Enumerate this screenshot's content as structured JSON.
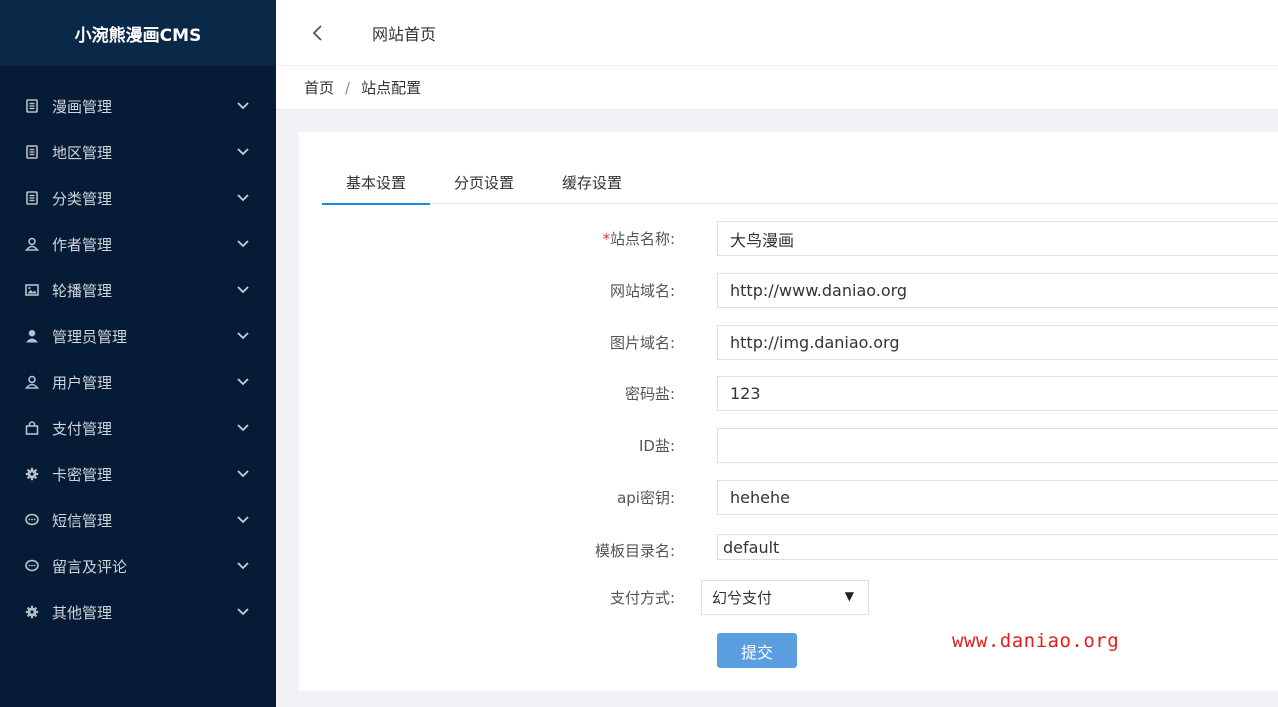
{
  "app": {
    "logo": "小涴熊漫画CMS"
  },
  "sidebar": {
    "items": [
      {
        "label": "漫画管理",
        "icon": "book-icon"
      },
      {
        "label": "地区管理",
        "icon": "book-icon"
      },
      {
        "label": "分类管理",
        "icon": "book-icon"
      },
      {
        "label": "作者管理",
        "icon": "user-outline-icon"
      },
      {
        "label": "轮播管理",
        "icon": "image-icon"
      },
      {
        "label": "管理员管理",
        "icon": "user-icon"
      },
      {
        "label": "用户管理",
        "icon": "user-outline-icon"
      },
      {
        "label": "支付管理",
        "icon": "bag-icon"
      },
      {
        "label": "卡密管理",
        "icon": "gear-icon"
      },
      {
        "label": "短信管理",
        "icon": "chat-icon"
      },
      {
        "label": "留言及评论",
        "icon": "chat-icon"
      },
      {
        "label": "其他管理",
        "icon": "gear-icon"
      }
    ]
  },
  "header": {
    "title": "网站首页"
  },
  "breadcrumb": {
    "home": "首页",
    "separator": "/",
    "current": "站点配置"
  },
  "tabs": [
    {
      "label": "基本设置",
      "active": true
    },
    {
      "label": "分页设置",
      "active": false
    },
    {
      "label": "缓存设置",
      "active": false
    }
  ],
  "form": {
    "site_name": {
      "required_mark": "*",
      "label": "站点名称:",
      "value": "大鸟漫画"
    },
    "site_domain": {
      "label": "网站域名:",
      "value": "http://www.daniao.org"
    },
    "img_domain": {
      "label": "图片域名:",
      "value": "http://img.daniao.org"
    },
    "pwd_salt": {
      "label": "密码盐:",
      "value": "123"
    },
    "id_salt": {
      "label": "ID盐:",
      "value": ""
    },
    "api_key": {
      "label": "api密钥:",
      "value": "hehehe"
    },
    "template_dir": {
      "label": "模板目录名:",
      "value": "default"
    },
    "payment": {
      "label": "支付方式:",
      "selected": "幻兮支付",
      "arrow": "▼"
    },
    "submit_label": "提交"
  },
  "watermark": "www.daniao.org",
  "colors": {
    "sidebar_bg": "#061c36",
    "logo_bg": "#0a2847",
    "accent": "#1e88e5",
    "submit": "#5b9ee0",
    "watermark": "#e0201e"
  }
}
